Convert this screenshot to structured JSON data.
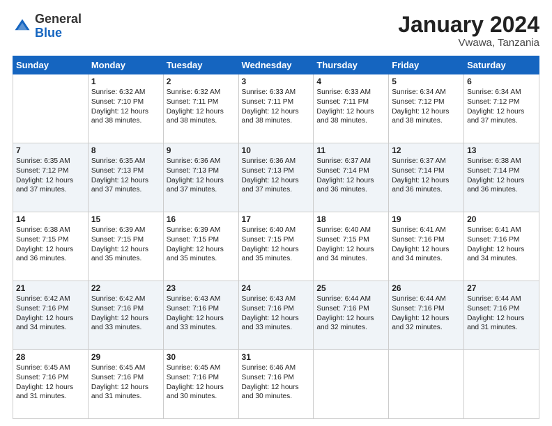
{
  "header": {
    "logo_general": "General",
    "logo_blue": "Blue",
    "month_title": "January 2024",
    "location": "Vwawa, Tanzania"
  },
  "days_of_week": [
    "Sunday",
    "Monday",
    "Tuesday",
    "Wednesday",
    "Thursday",
    "Friday",
    "Saturday"
  ],
  "weeks": [
    [
      {
        "day": "",
        "sunrise": "",
        "sunset": "",
        "daylight": "",
        "empty": true
      },
      {
        "day": "1",
        "sunrise": "Sunrise: 6:32 AM",
        "sunset": "Sunset: 7:10 PM",
        "daylight": "Daylight: 12 hours and 38 minutes."
      },
      {
        "day": "2",
        "sunrise": "Sunrise: 6:32 AM",
        "sunset": "Sunset: 7:11 PM",
        "daylight": "Daylight: 12 hours and 38 minutes."
      },
      {
        "day": "3",
        "sunrise": "Sunrise: 6:33 AM",
        "sunset": "Sunset: 7:11 PM",
        "daylight": "Daylight: 12 hours and 38 minutes."
      },
      {
        "day": "4",
        "sunrise": "Sunrise: 6:33 AM",
        "sunset": "Sunset: 7:11 PM",
        "daylight": "Daylight: 12 hours and 38 minutes."
      },
      {
        "day": "5",
        "sunrise": "Sunrise: 6:34 AM",
        "sunset": "Sunset: 7:12 PM",
        "daylight": "Daylight: 12 hours and 38 minutes."
      },
      {
        "day": "6",
        "sunrise": "Sunrise: 6:34 AM",
        "sunset": "Sunset: 7:12 PM",
        "daylight": "Daylight: 12 hours and 37 minutes."
      }
    ],
    [
      {
        "day": "7",
        "sunrise": "Sunrise: 6:35 AM",
        "sunset": "Sunset: 7:12 PM",
        "daylight": "Daylight: 12 hours and 37 minutes."
      },
      {
        "day": "8",
        "sunrise": "Sunrise: 6:35 AM",
        "sunset": "Sunset: 7:13 PM",
        "daylight": "Daylight: 12 hours and 37 minutes."
      },
      {
        "day": "9",
        "sunrise": "Sunrise: 6:36 AM",
        "sunset": "Sunset: 7:13 PM",
        "daylight": "Daylight: 12 hours and 37 minutes."
      },
      {
        "day": "10",
        "sunrise": "Sunrise: 6:36 AM",
        "sunset": "Sunset: 7:13 PM",
        "daylight": "Daylight: 12 hours and 37 minutes."
      },
      {
        "day": "11",
        "sunrise": "Sunrise: 6:37 AM",
        "sunset": "Sunset: 7:14 PM",
        "daylight": "Daylight: 12 hours and 36 minutes."
      },
      {
        "day": "12",
        "sunrise": "Sunrise: 6:37 AM",
        "sunset": "Sunset: 7:14 PM",
        "daylight": "Daylight: 12 hours and 36 minutes."
      },
      {
        "day": "13",
        "sunrise": "Sunrise: 6:38 AM",
        "sunset": "Sunset: 7:14 PM",
        "daylight": "Daylight: 12 hours and 36 minutes."
      }
    ],
    [
      {
        "day": "14",
        "sunrise": "Sunrise: 6:38 AM",
        "sunset": "Sunset: 7:15 PM",
        "daylight": "Daylight: 12 hours and 36 minutes."
      },
      {
        "day": "15",
        "sunrise": "Sunrise: 6:39 AM",
        "sunset": "Sunset: 7:15 PM",
        "daylight": "Daylight: 12 hours and 35 minutes."
      },
      {
        "day": "16",
        "sunrise": "Sunrise: 6:39 AM",
        "sunset": "Sunset: 7:15 PM",
        "daylight": "Daylight: 12 hours and 35 minutes."
      },
      {
        "day": "17",
        "sunrise": "Sunrise: 6:40 AM",
        "sunset": "Sunset: 7:15 PM",
        "daylight": "Daylight: 12 hours and 35 minutes."
      },
      {
        "day": "18",
        "sunrise": "Sunrise: 6:40 AM",
        "sunset": "Sunset: 7:15 PM",
        "daylight": "Daylight: 12 hours and 34 minutes."
      },
      {
        "day": "19",
        "sunrise": "Sunrise: 6:41 AM",
        "sunset": "Sunset: 7:16 PM",
        "daylight": "Daylight: 12 hours and 34 minutes."
      },
      {
        "day": "20",
        "sunrise": "Sunrise: 6:41 AM",
        "sunset": "Sunset: 7:16 PM",
        "daylight": "Daylight: 12 hours and 34 minutes."
      }
    ],
    [
      {
        "day": "21",
        "sunrise": "Sunrise: 6:42 AM",
        "sunset": "Sunset: 7:16 PM",
        "daylight": "Daylight: 12 hours and 34 minutes."
      },
      {
        "day": "22",
        "sunrise": "Sunrise: 6:42 AM",
        "sunset": "Sunset: 7:16 PM",
        "daylight": "Daylight: 12 hours and 33 minutes."
      },
      {
        "day": "23",
        "sunrise": "Sunrise: 6:43 AM",
        "sunset": "Sunset: 7:16 PM",
        "daylight": "Daylight: 12 hours and 33 minutes."
      },
      {
        "day": "24",
        "sunrise": "Sunrise: 6:43 AM",
        "sunset": "Sunset: 7:16 PM",
        "daylight": "Daylight: 12 hours and 33 minutes."
      },
      {
        "day": "25",
        "sunrise": "Sunrise: 6:44 AM",
        "sunset": "Sunset: 7:16 PM",
        "daylight": "Daylight: 12 hours and 32 minutes."
      },
      {
        "day": "26",
        "sunrise": "Sunrise: 6:44 AM",
        "sunset": "Sunset: 7:16 PM",
        "daylight": "Daylight: 12 hours and 32 minutes."
      },
      {
        "day": "27",
        "sunrise": "Sunrise: 6:44 AM",
        "sunset": "Sunset: 7:16 PM",
        "daylight": "Daylight: 12 hours and 31 minutes."
      }
    ],
    [
      {
        "day": "28",
        "sunrise": "Sunrise: 6:45 AM",
        "sunset": "Sunset: 7:16 PM",
        "daylight": "Daylight: 12 hours and 31 minutes."
      },
      {
        "day": "29",
        "sunrise": "Sunrise: 6:45 AM",
        "sunset": "Sunset: 7:16 PM",
        "daylight": "Daylight: 12 hours and 31 minutes."
      },
      {
        "day": "30",
        "sunrise": "Sunrise: 6:45 AM",
        "sunset": "Sunset: 7:16 PM",
        "daylight": "Daylight: 12 hours and 30 minutes."
      },
      {
        "day": "31",
        "sunrise": "Sunrise: 6:46 AM",
        "sunset": "Sunset: 7:16 PM",
        "daylight": "Daylight: 12 hours and 30 minutes."
      },
      {
        "day": "",
        "sunrise": "",
        "sunset": "",
        "daylight": "",
        "empty": true
      },
      {
        "day": "",
        "sunrise": "",
        "sunset": "",
        "daylight": "",
        "empty": true
      },
      {
        "day": "",
        "sunrise": "",
        "sunset": "",
        "daylight": "",
        "empty": true
      }
    ]
  ]
}
